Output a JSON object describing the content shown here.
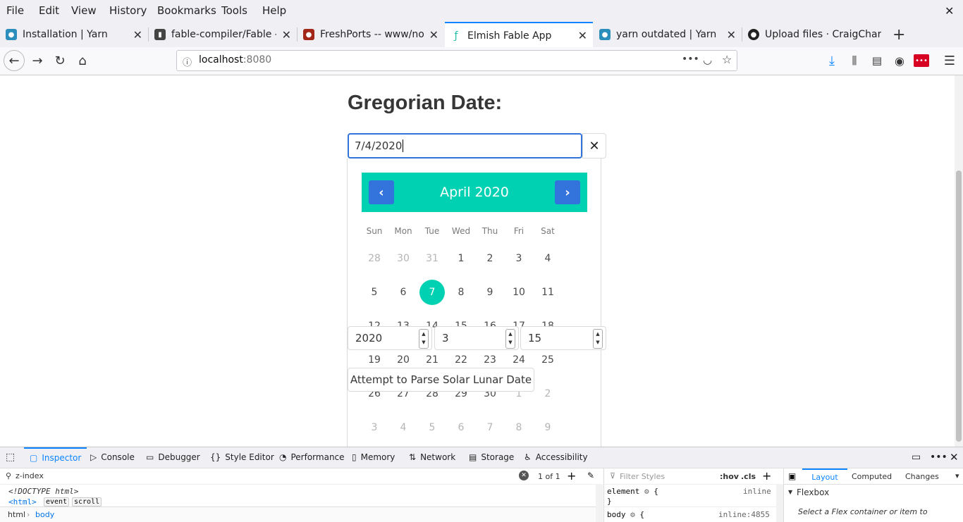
{
  "menubar": {
    "items": [
      "File",
      "Edit",
      "View",
      "History",
      "Bookmarks",
      "Tools",
      "Help"
    ],
    "close": "✕"
  },
  "tabs": [
    {
      "title": "Installation | Yarn",
      "favicon_color": "#2c8ebb",
      "active": false
    },
    {
      "title": "fable-compiler/Fable - G",
      "favicon_color": "#444444",
      "active": false
    },
    {
      "title": "FreshPorts -- www/noc",
      "favicon_color": "#a3261b",
      "active": false
    },
    {
      "title": "Elmish Fable App",
      "favicon_color": "#1fbfa9",
      "active": true
    },
    {
      "title": "yarn outdated | Yarn",
      "favicon_color": "#2c8ebb",
      "active": false
    },
    {
      "title": "Upload files · CraigChar",
      "favicon_color": "#222222",
      "active": false
    }
  ],
  "navbar": {
    "url_host": "localhost",
    "url_port": ":8080",
    "more_icon": "•••"
  },
  "page": {
    "heading": "Gregorian Date:",
    "date_value": "7/4/2020",
    "clear_icon": "✕",
    "calendar": {
      "month_label": "April 2020",
      "prev_icon": "‹",
      "next_icon": "›",
      "weekdays": [
        "Sun",
        "Mon",
        "Tue",
        "Wed",
        "Thu",
        "Fri",
        "Sat"
      ],
      "weeks": [
        [
          "28",
          "30",
          "31",
          "1",
          "2",
          "3",
          "4"
        ],
        [
          "5",
          "6",
          "7",
          "8",
          "9",
          "10",
          "11"
        ],
        [
          "12",
          "13",
          "14",
          "15",
          "16",
          "17",
          "18"
        ],
        [
          "19",
          "20",
          "21",
          "22",
          "23",
          "24",
          "25"
        ],
        [
          "26",
          "27",
          "28",
          "29",
          "30",
          "1",
          "2"
        ],
        [
          "3",
          "4",
          "5",
          "6",
          "7",
          "8",
          "9"
        ]
      ],
      "selected_day": "7"
    },
    "year_value": "2020",
    "month_value": "3",
    "day_value": "15",
    "parse_button": "Attempt to Parse Solar Lunar Date"
  },
  "devtools": {
    "tabs": [
      "Inspector",
      "Console",
      "Debugger",
      "Style Editor",
      "Performance",
      "Memory",
      "Network",
      "Storage",
      "Accessibility"
    ],
    "search_value": "z-index",
    "search_count": "1 of 1",
    "html_lines": [
      "<!DOCTYPE html>",
      "<html>"
    ],
    "html_badges": [
      "event",
      "scroll"
    ],
    "breadcrumb": [
      "html",
      "body"
    ],
    "filter_placeholder": "Filter Styles",
    "hov": ":hov",
    "cls": ".cls",
    "rules": [
      {
        "selector": "element",
        "source": "inline",
        "brace": "{"
      },
      {
        "selector": "body",
        "source": "inline:4855",
        "brace": "{"
      }
    ],
    "close_brace": "}",
    "side_tabs": [
      "Layout",
      "Computed",
      "Changes"
    ],
    "flexbox_title": "Flexbox",
    "flexbox_hint": "Select a Flex container or item to"
  }
}
